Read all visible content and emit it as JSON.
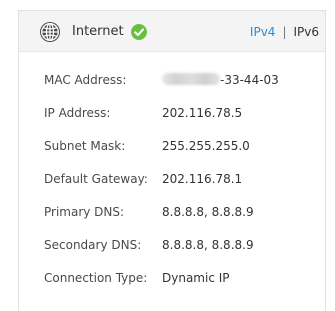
{
  "header": {
    "title": "Internet",
    "status_icon": "check-circle-icon",
    "status_color": "#6abf40",
    "icon": "globe-icon",
    "ipv4_label": "IPv4",
    "separator": "|",
    "ipv6_label": "IPv6",
    "accent_color": "#2b8bd4"
  },
  "details": [
    {
      "label": "MAC Address:",
      "value": "-33-44-03",
      "value_partially_blurred": true
    },
    {
      "label": "IP Address:",
      "value": "202.116.78.5"
    },
    {
      "label": "Subnet Mask:",
      "value": "255.255.255.0"
    },
    {
      "label": "Default Gateway:",
      "value": "202.116.78.1"
    },
    {
      "label": "Primary DNS:",
      "value": "8.8.8.8, 8.8.8.9"
    },
    {
      "label": "Secondary DNS:",
      "value": "8.8.8.8, 8.8.8.9"
    },
    {
      "label": "Connection Type:",
      "value": "Dynamic IP"
    }
  ]
}
